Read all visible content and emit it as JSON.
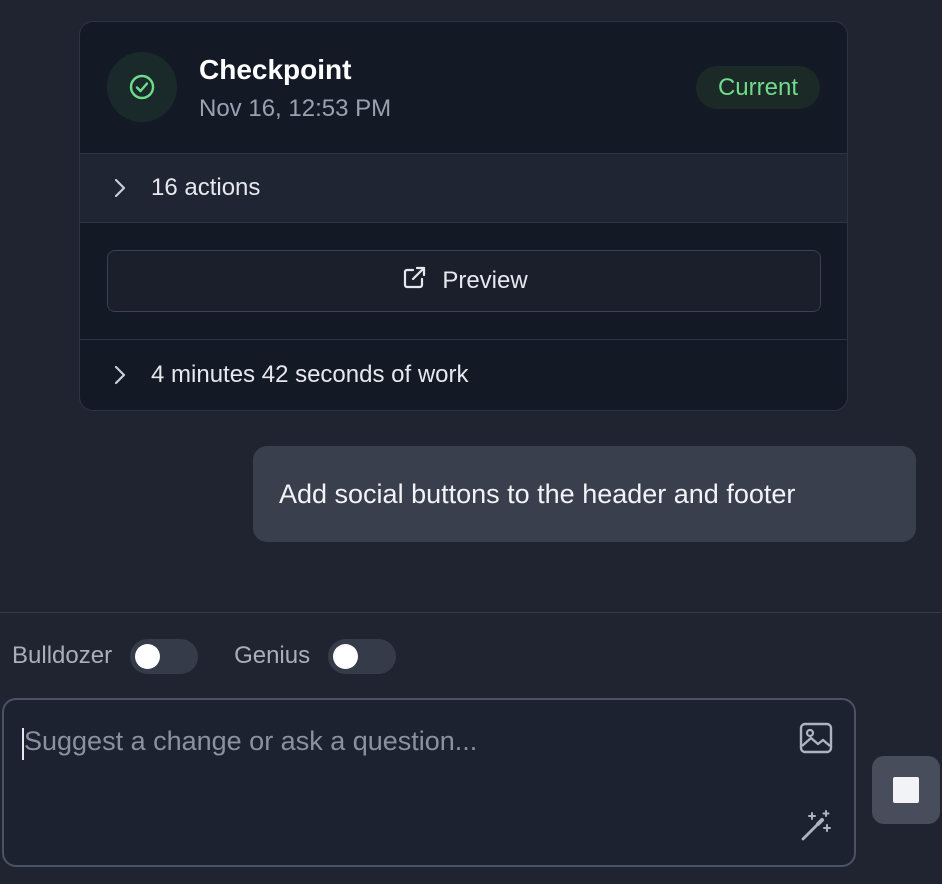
{
  "checkpoint": {
    "title": "Checkpoint",
    "timestamp": "Nov 16, 12:53 PM",
    "badge": "Current",
    "actions_label": "16 actions",
    "preview_label": "Preview",
    "work_label": "4 minutes 42 seconds of work"
  },
  "message": {
    "text": "Add social buttons to the header and footer"
  },
  "toggles": {
    "bulldozer_label": "Bulldozer",
    "genius_label": "Genius"
  },
  "composer": {
    "placeholder": "Suggest a change or ask a question..."
  },
  "icons": {
    "check": "check-circle-icon",
    "chevron": "chevron-right-icon",
    "external": "external-link-icon",
    "image": "image-icon",
    "wand": "magic-wand-icon",
    "stop": "stop-icon"
  },
  "colors": {
    "accent_green": "#6fdc8c",
    "background": "#1f2430",
    "card": "#141926"
  }
}
